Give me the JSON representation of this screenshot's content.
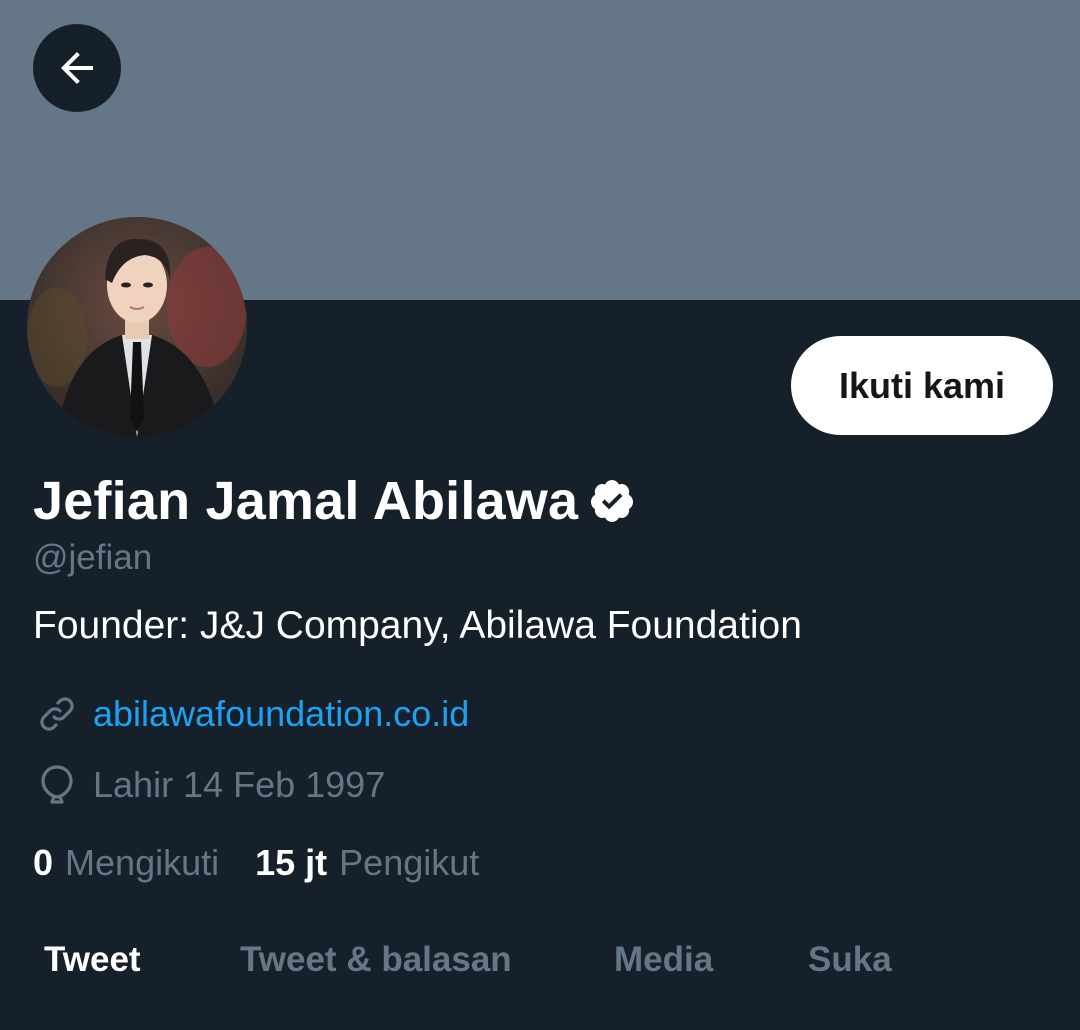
{
  "header": {
    "back_icon": "arrow-left-icon",
    "banner_color": "#657786"
  },
  "profile": {
    "display_name": "Jefian Jamal Abilawa",
    "verified_icon": "verified-badge-icon",
    "handle": "@jefian",
    "bio": "Founder: J&J Company, Abilawa Foundation",
    "website": "abilawafoundation.co.id",
    "website_icon": "link-icon",
    "birth": "Lahir 14 Feb 1997",
    "birth_icon": "balloon-icon",
    "follow_label": "Ikuti kami"
  },
  "stats": {
    "following_count": "0",
    "following_label": "Mengikuti",
    "followers_count": "15 jt",
    "followers_label": "Pengikut"
  },
  "tabs": [
    {
      "label": "Tweet",
      "active": true
    },
    {
      "label": "Tweet & balasan",
      "active": false
    },
    {
      "label": "Media",
      "active": false
    },
    {
      "label": "Suka",
      "active": false
    }
  ],
  "colors": {
    "background": "#15202b",
    "accent": "#1da1f2",
    "muted": "#657786",
    "text": "#ffffff"
  }
}
